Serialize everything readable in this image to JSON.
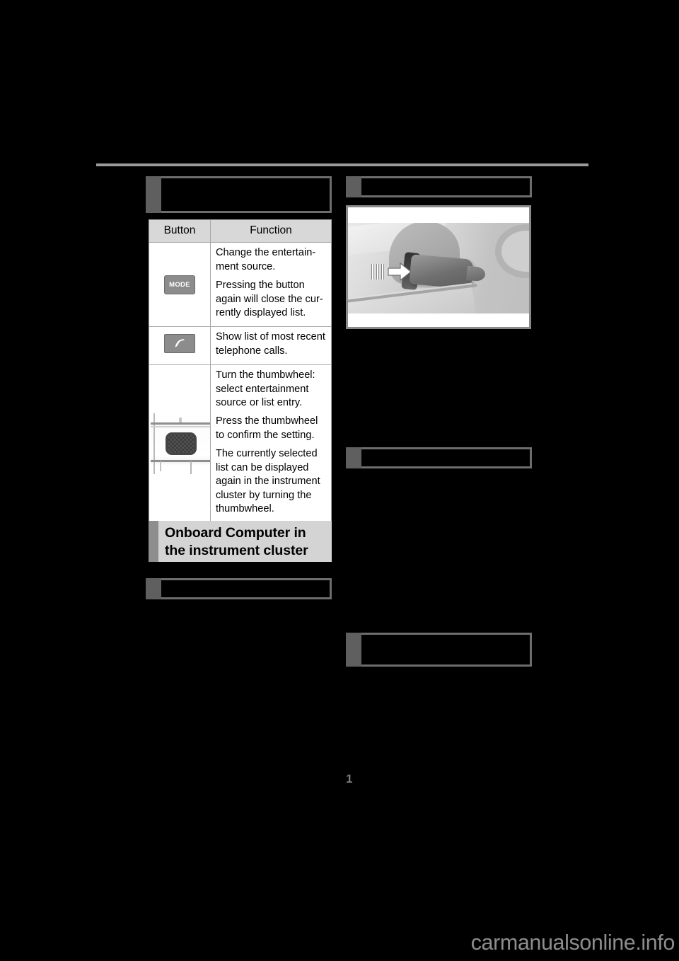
{
  "document": {
    "page_number": "1",
    "watermark": "carmanualsonline.info",
    "rule_color": "#9a9a9a",
    "page_background": "#000000"
  },
  "left_column": {
    "heading_top": {
      "text": "",
      "redacted": true,
      "tab_color": "#5f5f5f",
      "border_color": "#6d6d6d"
    },
    "table": {
      "columns": [
        "Button",
        "Function"
      ],
      "header_background": "#d8d8d8",
      "rows": [
        {
          "button_icon": "mode-key-icon",
          "button_label": "MODE",
          "functions": [
            "Change the entertain-ment source.",
            "Pressing the button again will close the cur-rently displayed list."
          ]
        },
        {
          "button_icon": "phone-key-icon",
          "button_label": "",
          "functions": [
            "Show list of most recent telephone calls."
          ]
        },
        {
          "button_icon": "thumbwheel-photo-icon",
          "button_label": "",
          "functions": [
            "Turn the thumbwheel: select entertainment source or list entry.",
            "Press the thumbwheel to confirm the setting.",
            "The currently selected list can be displayed again in the instrument cluster by turning the thumbwheel."
          ]
        }
      ]
    },
    "heading_onboard": {
      "text": "Onboard Computer in the instrument cluster",
      "redacted": false,
      "background": "#d4d4d4",
      "tab_color": "#8e8e8e"
    },
    "heading_lower": {
      "text": "",
      "redacted": true,
      "tab_color": "#5f5f5f",
      "border_color": "#6d6d6d"
    }
  },
  "right_column": {
    "heading_top": {
      "text": "",
      "redacted": true,
      "tab_color": "#5f5f5f",
      "border_color": "#6d6d6d"
    },
    "illustration": {
      "name": "steering-column-stalk-illustration",
      "caption": "",
      "frame_color": "#8a8a8a",
      "annotation_icon": "press-arrow-icon"
    },
    "heading_middle": {
      "text": "",
      "redacted": true,
      "tab_color": "#5f5f5f",
      "border_color": "#6d6d6d"
    },
    "heading_bottom": {
      "text": "",
      "redacted": true,
      "tab_color": "#5f5f5f",
      "border_color": "#6d6d6d"
    }
  }
}
